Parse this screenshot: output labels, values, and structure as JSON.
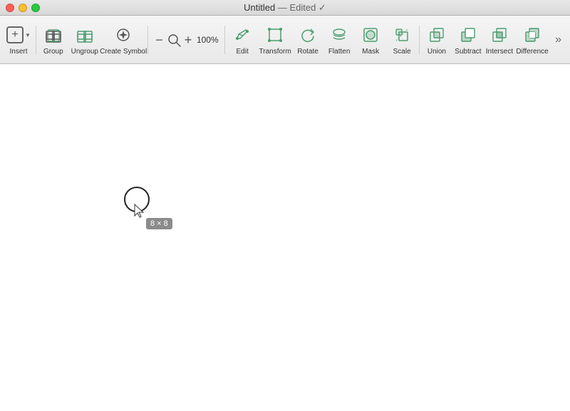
{
  "titlebar": {
    "title": "Untitled",
    "edited_label": " — Edited ✓"
  },
  "toolbar": {
    "insert_label": "Insert",
    "group_label": "Group",
    "ungroup_label": "Ungroup",
    "create_symbol_label": "Create Symbol",
    "zoom_minus": "−",
    "zoom_value": "100%",
    "zoom_plus": "+",
    "edit_label": "Edit",
    "transform_label": "Transform",
    "rotate_label": "Rotate",
    "flatten_label": "Flatten",
    "mask_label": "Mask",
    "scale_label": "Scale",
    "union_label": "Union",
    "subtract_label": "Subtract",
    "intersect_label": "Intersect",
    "difference_label": "Difference",
    "more_label": "»"
  },
  "canvas": {
    "circle_size": "8 × 8",
    "bg_color": "#ffffff"
  }
}
